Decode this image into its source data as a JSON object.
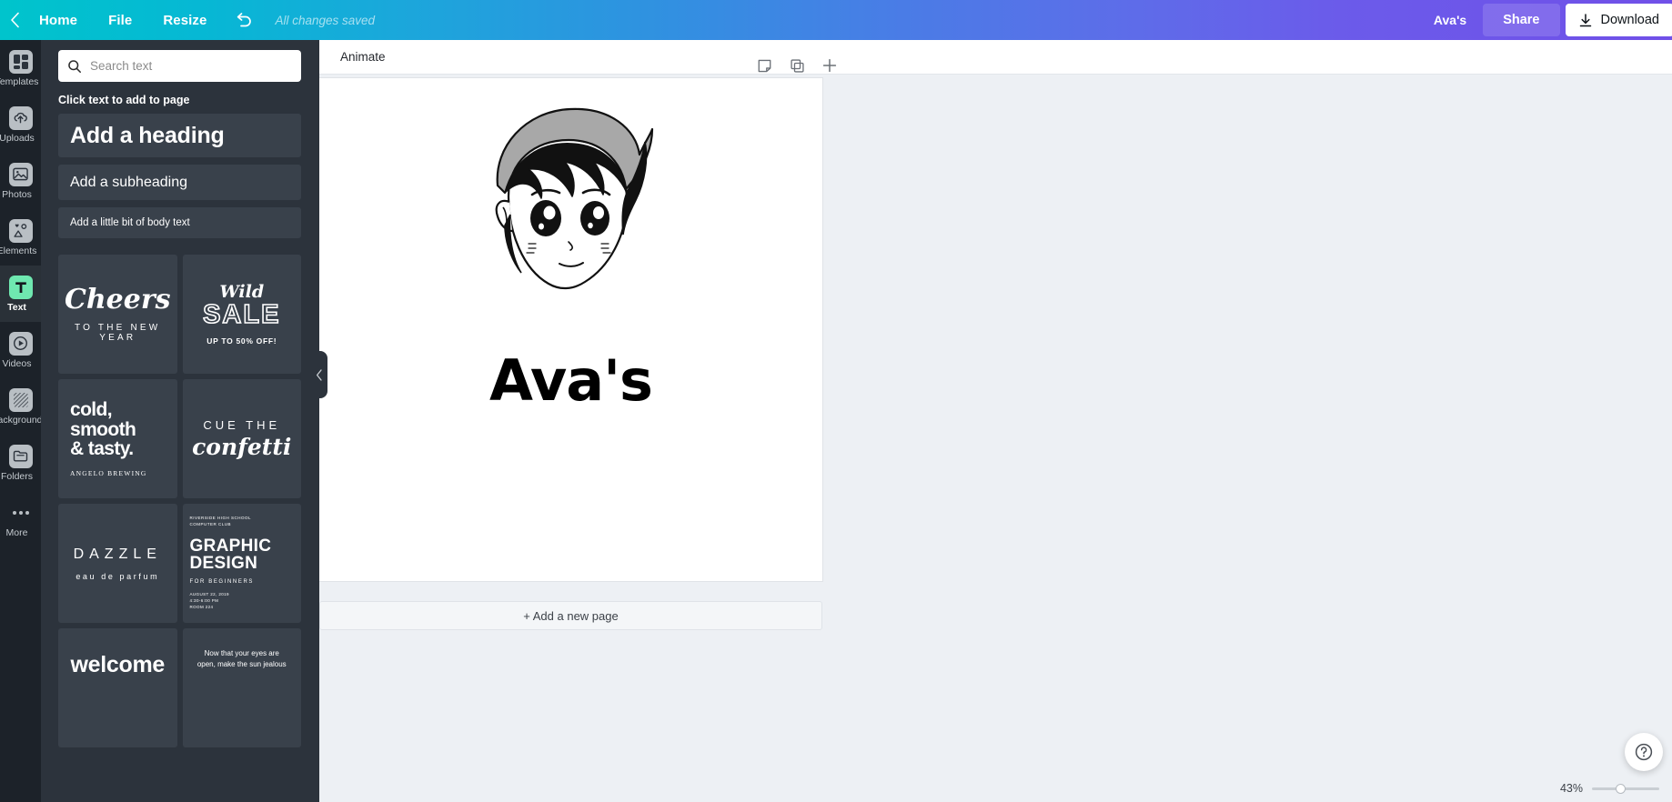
{
  "topbar": {
    "back_icon": "chevron-left-icon",
    "home": "Home",
    "file": "File",
    "resize": "Resize",
    "undo_icon": "undo-icon",
    "status": "All changes saved",
    "user": "Ava's",
    "share": "Share",
    "download": "Download",
    "download_icon": "download-icon",
    "gradient_start": "#00c4cc",
    "gradient_end": "#7050e8"
  },
  "rail": {
    "items": [
      {
        "label": "Templates",
        "icon": "templates-icon",
        "active": false
      },
      {
        "label": "Uploads",
        "icon": "upload-cloud-icon",
        "active": false
      },
      {
        "label": "Photos",
        "icon": "photo-icon",
        "active": false
      },
      {
        "label": "Elements",
        "icon": "shapes-icon",
        "active": false
      },
      {
        "label": "Text",
        "icon": "text-t-icon",
        "active": true
      },
      {
        "label": "Videos",
        "icon": "play-icon",
        "active": false
      },
      {
        "label": "Background",
        "icon": "hatch-pattern-icon",
        "active": false
      },
      {
        "label": "Folders",
        "icon": "folder-icon",
        "active": false
      },
      {
        "label": "More",
        "icon": "ellipsis-icon",
        "active": false
      }
    ],
    "active_accent": "#6fe8b0"
  },
  "panel": {
    "search_placeholder": "Search text",
    "search_value": "",
    "search_icon": "search-icon",
    "hint": "Click text to add to page",
    "presets": {
      "heading": "Add a heading",
      "subheading": "Add a subheading",
      "body": "Add a little bit of body text"
    },
    "templates": [
      {
        "line1": "Cheers",
        "line2": "TO THE NEW YEAR"
      },
      {
        "line1": "Wild",
        "line2": "SALE",
        "line3": "UP TO 50% OFF!"
      },
      {
        "line1": "cold,\nsmooth\n& tasty.",
        "line2": "ANGELO BREWING"
      },
      {
        "line1": "CUE THE",
        "line2": "confetti"
      },
      {
        "line1": "DAZZLE",
        "line2": "eau de parfum"
      },
      {
        "line0": "RIVERSIDE HIGH SCHOOL\nCOMPUTER CLUB",
        "line1": "GRAPHIC\nDESIGN",
        "line2": "FOR BEGINNERS",
        "line3": "AUGUST 22, 2019\n4:30-6:00 PM\nROOM 224"
      },
      {
        "line1": "welcome"
      },
      {
        "line1": "Now that your eyes are open, make the sun jealous"
      }
    ],
    "collapse_icon": "chevron-left-icon"
  },
  "main": {
    "animate_label": "Animate",
    "page_tools": [
      {
        "name": "notes-icon",
        "glyph": "note"
      },
      {
        "name": "duplicate-page-icon",
        "glyph": "copy"
      },
      {
        "name": "add-page-icon",
        "glyph": "plus"
      }
    ],
    "design_text": "Ava's",
    "add_page_label": "+ Add a new page",
    "zoom_level": "43%",
    "help_icon": "help-icon"
  }
}
